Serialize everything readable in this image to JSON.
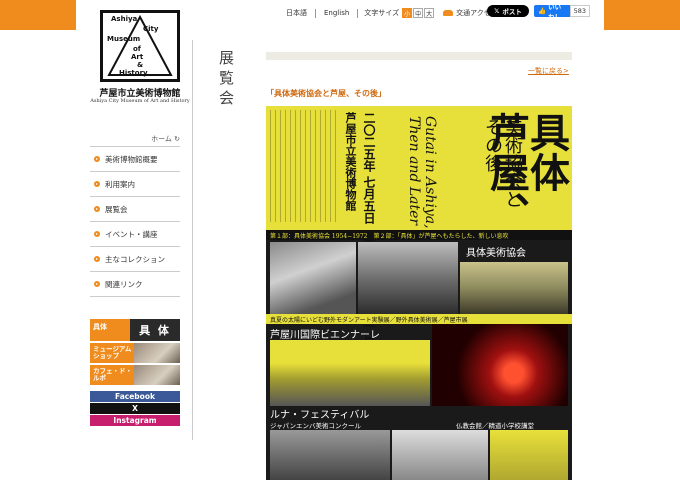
{
  "logo": {
    "box_text": [
      "Ashiya",
      "City",
      "Museum",
      "of",
      "Art",
      "&",
      "History"
    ],
    "title": "芦屋市立美術博物館",
    "subtitle": "Ashiya City Museum of Art and History"
  },
  "header": {
    "lang_ja": "日本語",
    "lang_en": "English",
    "font_size_label": "文字サイズ",
    "font_sizes": [
      "小",
      "中",
      "大"
    ],
    "access_label": "交通アクセス",
    "x_post": "ポスト",
    "fb_like": "いいね！",
    "fb_count": "583"
  },
  "sidebar": {
    "home_link": "ホーム",
    "nav_items": [
      {
        "label": "美術博物館概要"
      },
      {
        "label": "利用案内"
      },
      {
        "label": "展覧会"
      },
      {
        "label": "イベント・講座"
      },
      {
        "label": "主なコレクション"
      },
      {
        "label": "関連リンク"
      }
    ],
    "banners": {
      "gutai_small": "具体",
      "gutai_big": "具 体",
      "shop": "ミュージアム\nショップ",
      "cafe": "カフェ・ド・\nルポ"
    },
    "sns": {
      "facebook": "Facebook",
      "x": "X",
      "instagram": "Instagram"
    }
  },
  "page": {
    "title": "展覧会",
    "back_link": "一覧に戻る>",
    "exhibition_heading": "「具体美術協会と芦屋、その後」"
  },
  "poster": {
    "main_title": "具体\n芦屋、",
    "sub_title": "美術協会と\nその後",
    "english": "Gutai in Ashiya,\nThen and Later",
    "date": "二〇二五年 七月五日（土）－八月三十一日（日）",
    "venue": "芦屋市立美術博物館",
    "band1": "第１部：具体美術協会 1954−1972　第２部：「具体」が芦屋へもたらした、新しい息吹",
    "gutai_kyokai": "具体美術協会",
    "band2": "真夏の太陽にいどむ野外モダンアート実験展／野外具体美術展／芦屋市展",
    "biennale": "芦屋川国際ビエンナーレ",
    "luna": "ルナ・フェスティバル",
    "jpn_competition": "ジャパンエンバ美術コンクール",
    "bukkyo": "仏教会館／精道小学校講堂"
  },
  "colors": {
    "accent": "#f08c1e",
    "link": "#d06a10",
    "poster_yellow": "#e8e03a"
  }
}
